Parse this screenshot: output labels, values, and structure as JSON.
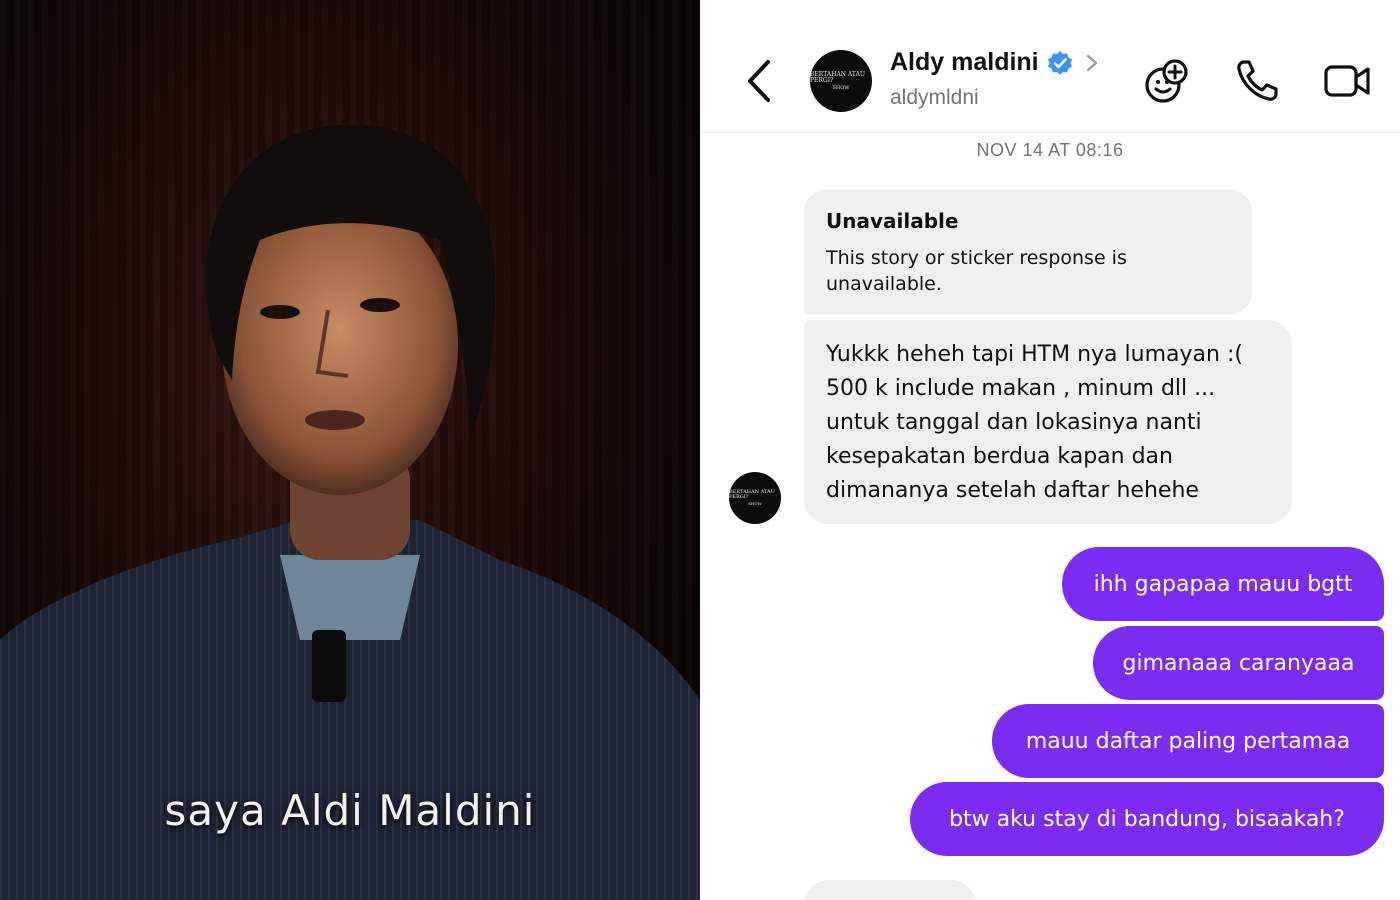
{
  "video": {
    "caption": "saya Aldi Maldini"
  },
  "chat": {
    "header": {
      "name": "Aldy maldini",
      "handle": "aldymldni",
      "avatar_line1": "BERTAHAN ATAU PERGI?",
      "avatar_line2": "SHOW",
      "verified_color": "#3897f0"
    },
    "timestamp": "NOV 14 AT 08:16",
    "messages": {
      "unavailable": {
        "title": "Unavailable",
        "body": "This story or sticker response is unavailable."
      },
      "htm": "Yukkk heheh tapi HTM nya lumayan :( 500 k include makan , minum dll ... untuk tanggal dan lokasinya nanti kesepakatan berdua kapan dan dimananya setelah daftar hehehe",
      "sent": [
        "ihh gapapaa mauu bgtt",
        "gimanaaa caranyaaa",
        "mauu daftar paling pertamaa",
        "btw aku stay di bandung, bisaakah?"
      ]
    },
    "colors": {
      "sent_bubble": "#7a2cf0",
      "received_bubble": "#efefef"
    },
    "icons": [
      "back-arrow-icon",
      "verified-badge-icon",
      "chevron-right-icon",
      "effects-icon",
      "phone-icon",
      "video-camera-icon"
    ]
  }
}
